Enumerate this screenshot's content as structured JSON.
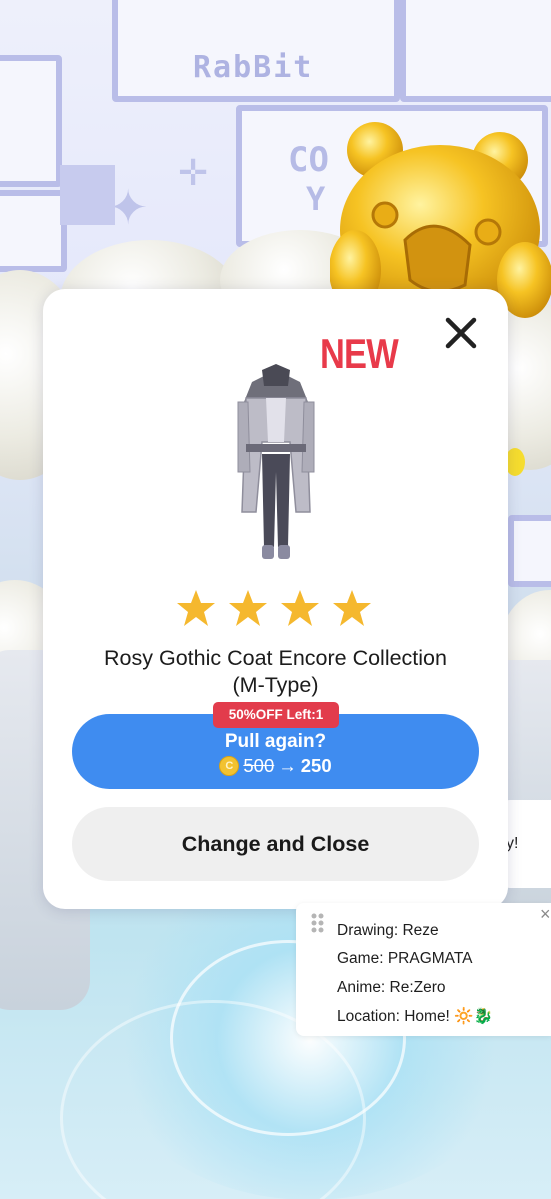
{
  "background": {
    "sign_text": "RabBit",
    "window_text_1": "CO",
    "window_text_2": "Y"
  },
  "modal": {
    "badge": "NEW",
    "rarity_stars": 4,
    "item_name_line1": "Rosy Gothic Coat Encore Collection",
    "item_name_line2": "(M-Type)",
    "discount_badge": "50%OFF Left:1",
    "pull_button": {
      "label": "Pull again?",
      "coin_glyph": "C",
      "old_price": "500",
      "arrow": "→",
      "new_price": "250"
    },
    "change_button_label": "Change and Close",
    "close_icon": "close-icon"
  },
  "side_card": {
    "lines": [
      "Drawing: Reze",
      "Game: PRAGMATA",
      "Anime: Re:Zero",
      "Location: Home! 🔆🐉"
    ],
    "close_glyph": "×"
  },
  "peek_card": {
    "text": "y!"
  },
  "colors": {
    "accent_blue": "#3f8cf0",
    "badge_red": "#e83a4a",
    "star_gold": "#f5b82e"
  }
}
